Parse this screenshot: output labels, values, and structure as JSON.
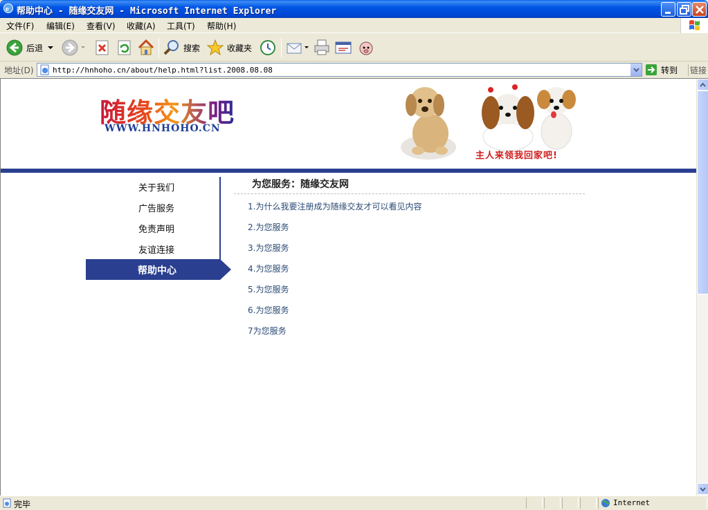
{
  "window": {
    "title": "帮助中心 - 随缘交友网 - Microsoft Internet Explorer"
  },
  "menu": [
    "文件(F)",
    "编辑(E)",
    "查看(V)",
    "收藏(A)",
    "工具(T)",
    "帮助(H)"
  ],
  "toolbar": {
    "back_label": "后退",
    "search_label": "搜索",
    "favorites_label": "收藏夹"
  },
  "address": {
    "label": "地址(D)",
    "url": "http://hnhoho.cn/about/help.html?list.2008.08.08",
    "go_label": "转到",
    "links_label": "链接"
  },
  "page": {
    "logo_text": "随缘交友吧",
    "logo_url": "WWW.HNHOHO.CN",
    "banner_slogan": "主人来领我回家吧!",
    "nav_items": [
      "关于我们",
      "广告服务",
      "免责声明",
      "友谊连接"
    ],
    "nav_active": "帮助中心",
    "section_title": "为您服务：随缘交友网",
    "questions": [
      "1.为什么我要注册成为随缘交友才可以看见内容",
      "2.为您服务",
      "3.为您服务",
      "4.为您服务",
      "5.为您服务",
      "6.为您服务",
      "7为您服务"
    ]
  },
  "status": {
    "text": "完毕",
    "zone": "Internet"
  },
  "colors": {
    "accent_navy": "#2A3F8F",
    "link": "#2A4A74",
    "slogan_red": "#D11E1E"
  },
  "icons": [
    "ie-icon",
    "minimize-icon",
    "maximize-icon",
    "close-icon",
    "windows-logo-icon",
    "back-icon",
    "forward-icon",
    "stop-icon",
    "refresh-icon",
    "home-icon",
    "search-icon",
    "favorites-star-icon",
    "history-icon",
    "mail-icon",
    "print-icon",
    "edit-icon",
    "messenger-icon",
    "page-icon",
    "go-arrow-icon",
    "globe-icon"
  ]
}
